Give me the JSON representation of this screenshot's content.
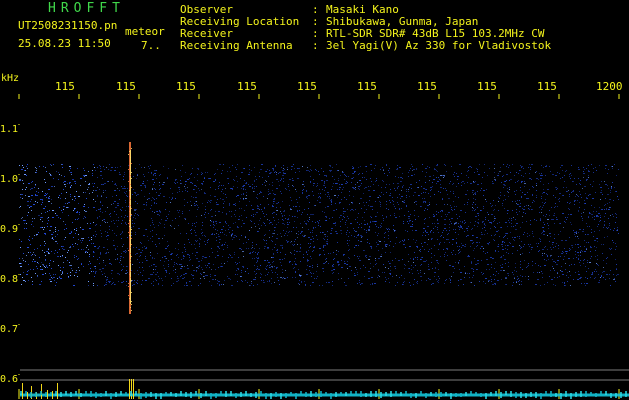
{
  "header": {
    "app_title": "HROFFT",
    "file_name": "UT2508231150.pn",
    "meteor_label": "meteor",
    "date_time": "25.08.23 11:50",
    "truncated_value": "7..",
    "unit": "kHz"
  },
  "info": {
    "rows": [
      {
        "label": "Observer",
        "value": "Masaki Kano"
      },
      {
        "label": "Receiving Location",
        "value": "Shibukawa, Gunma, Japan"
      },
      {
        "label": "Receiver",
        "value": "RTL-SDR SDR# 43dB L15 103.2MHz CW"
      },
      {
        "label": "Receiving Antenna",
        "value": "3el Yagi(V) Az 330 for Vladivostok"
      }
    ],
    "separator": ":"
  },
  "axes": {
    "x_ticks": [
      "115",
      "115",
      "115",
      "115",
      "115",
      "115",
      "115",
      "115",
      "115",
      "1200"
    ],
    "y_ticks": [
      "1.1",
      "1.0",
      "0.9",
      "0.8",
      "0.7",
      "0.6"
    ]
  },
  "colors": {
    "background": "#000000",
    "text": "#f4f41c",
    "title": "#40d84a",
    "noise": "#2147d5",
    "noise_bright": "#6f9cff",
    "meteor_trace": "#ff7a3c",
    "meteor_trace_core": "#ffe06b",
    "baseline_bars": "#ffe31b",
    "horizontal_lines": "#9c9c9c"
  }
}
